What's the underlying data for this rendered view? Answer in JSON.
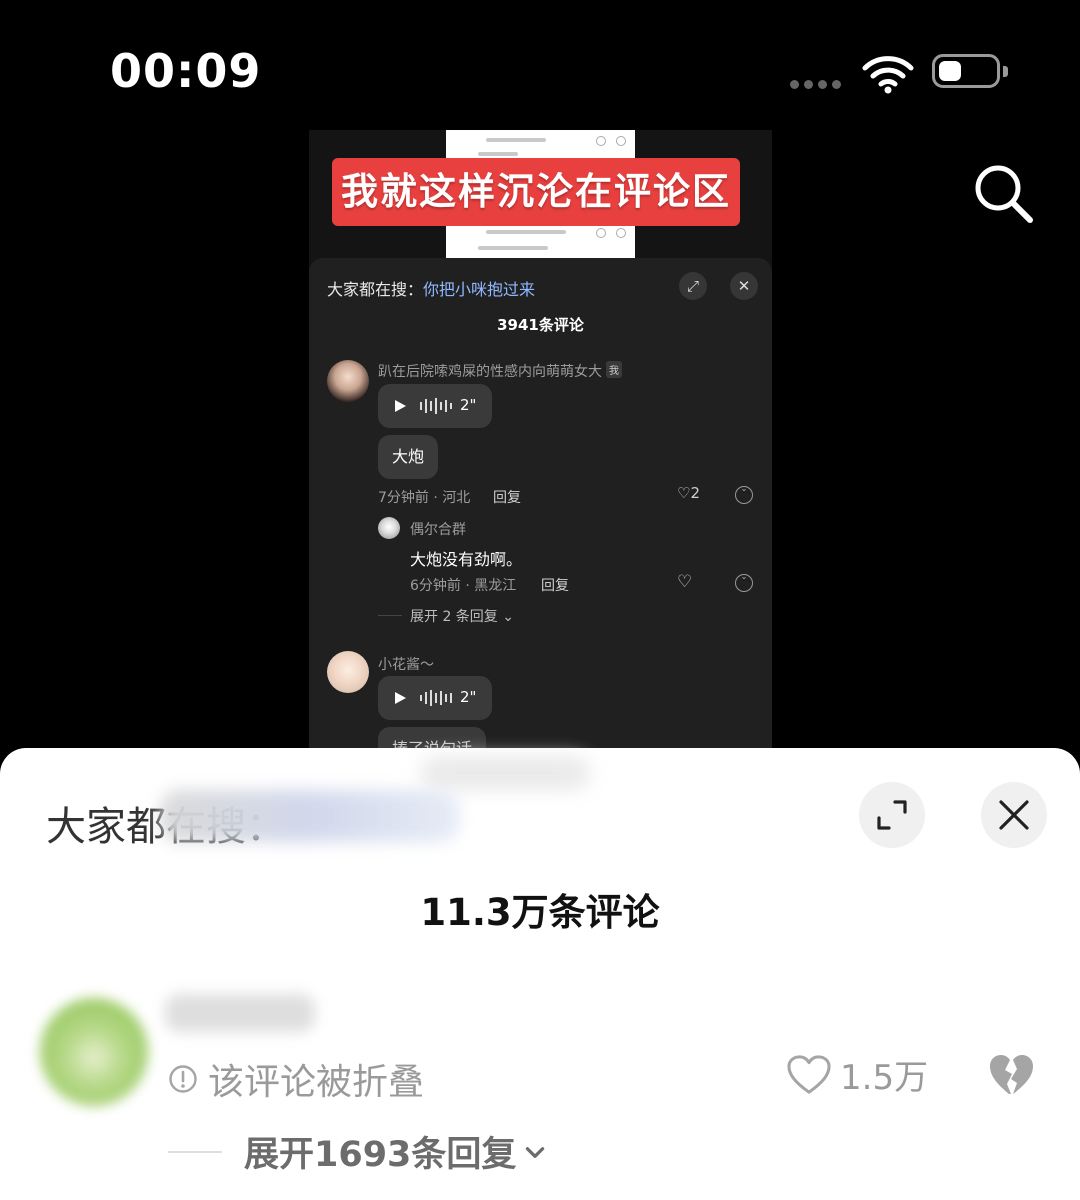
{
  "status_bar": {
    "time": "00:09"
  },
  "video": {
    "title_banner": "我就这样沉沦在评论区",
    "inner_comments": {
      "search_label": "大家都在搜：",
      "search_term": "你把小咪抱过来",
      "count": "3941条评论",
      "comments": [
        {
          "username": "趴在后院嗦鸡屎的性感内向萌萌女大",
          "me_tag": "我",
          "voice_duration": "2\"",
          "text": "大炮",
          "meta": "7分钟前 · 河北",
          "reply_label": "回复",
          "likes": "2",
          "reply": {
            "username": "偶尔合群",
            "text": "大炮没有劲啊。",
            "meta": "6分钟前 · 黑龙江",
            "reply_label": "回复"
          },
          "expand_label": "展开 2 条回复"
        },
        {
          "username": "小花酱～",
          "voice_duration": "2\"",
          "text_partial": "揍了说句话"
        }
      ]
    }
  },
  "sheet": {
    "search_label": "大家都在搜：",
    "count": "11.3万条评论",
    "comment": {
      "folded_text": "该评论被折叠",
      "likes": "1.5万",
      "expand_label": "展开1693条回复"
    }
  },
  "icons": {
    "search": "search-icon",
    "wifi": "wifi-icon",
    "battery": "battery-icon",
    "expand": "expand-icon",
    "close": "close-icon",
    "heart": "heart-icon",
    "broken_heart": "broken-heart-icon",
    "info": "info-icon",
    "chevron": "chevron-down-icon"
  },
  "colors": {
    "banner_red": "#e7403f",
    "link_blue": "#8fb9ff",
    "sheet_bg": "#ffffff",
    "muted_text": "#9a9a9a"
  }
}
